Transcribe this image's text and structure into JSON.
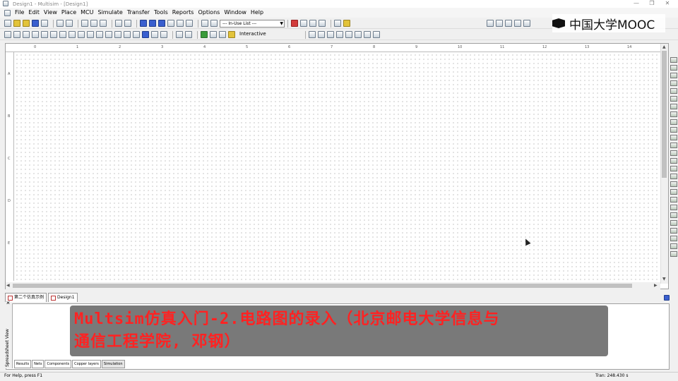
{
  "window": {
    "title": "Design1 - Multisim - [Design1]",
    "controls": [
      "—",
      "❐",
      "✕"
    ]
  },
  "menu": [
    "File",
    "Edit",
    "View",
    "Place",
    "MCU",
    "Simulate",
    "Transfer",
    "Tools",
    "Reports",
    "Options",
    "Window",
    "Help"
  ],
  "toolbar": {
    "in_use_list": "--- In-Use List ---",
    "interactive_label": "Interactive"
  },
  "watermark": {
    "text": "中国大学MOOC"
  },
  "ruler": {
    "horizontal": [
      "0",
      "1",
      "2",
      "3",
      "4",
      "5",
      "6",
      "7",
      "8",
      "9",
      "10",
      "11",
      "12",
      "13",
      "14"
    ],
    "vertical": [
      "A",
      "B",
      "C",
      "D",
      "E"
    ]
  },
  "sheet_tabs": [
    "第二个仿真示例",
    "Design1"
  ],
  "spreadsheet": {
    "side_label": "Spreadsheet View",
    "tabs": [
      "Results",
      "Nets",
      "Components",
      "Copper layers",
      "Simulation"
    ],
    "active_tab": "Simulation"
  },
  "banner": {
    "line1": "Multsim仿真入门-2.电路图的录入（北京邮电大学信息与",
    "line2": "通信工程学院, 邓钢）"
  },
  "status": {
    "left": "For Help, press F1",
    "right": "Tran: 248.430 s"
  },
  "colors": {
    "banner_text": "#ff2222",
    "banner_bg": "#6e6e6e"
  }
}
